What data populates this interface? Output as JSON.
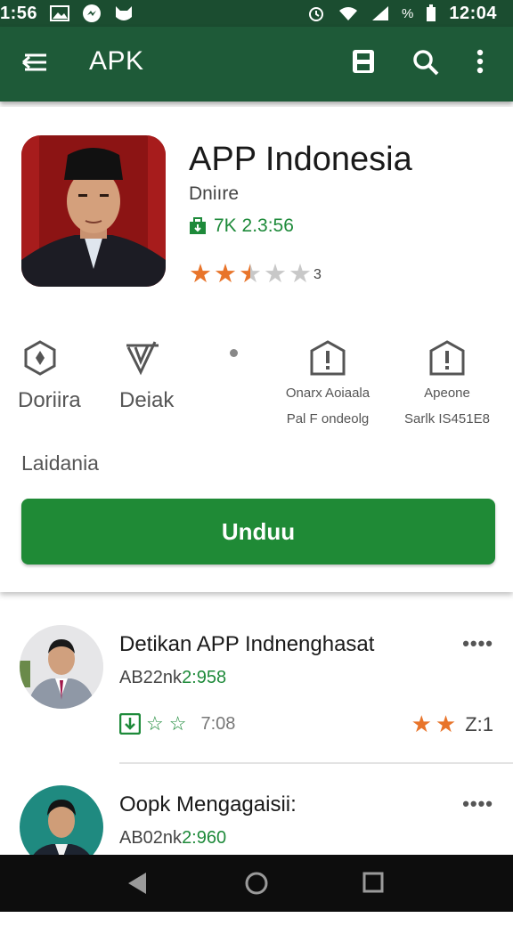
{
  "status": {
    "time_left": "1:56",
    "battery_pct": "%",
    "time_right": "12:04"
  },
  "appbar": {
    "title": "APK",
    "icons": [
      "menu-icon",
      "save-icon",
      "search-icon",
      "more-vert-icon"
    ]
  },
  "app": {
    "title": "APP Indonesia",
    "developer": "Dniıre",
    "meta": "7K 2.3:56",
    "rating_tail": "3",
    "rating": 2.5
  },
  "stats": [
    {
      "label": "Doriira",
      "icon": "hexagon-icon"
    },
    {
      "label": "Deiak",
      "icon": "download-arrow-icon"
    },
    {
      "label_line1": "Onarx Aoiaala",
      "label_line2": "Pal F ondeolg",
      "icon": "info-shield-icon"
    },
    {
      "label_line1": "Apeone",
      "label_line2": "Sarlk IS451E8",
      "icon": "info-shield-icon"
    }
  ],
  "section_label": "Laidania",
  "install_label": "Unduu",
  "list": [
    {
      "title": "Detikan APP Indnenghasat",
      "sub_prefix": "AB22nk",
      "sub_value": "2:958",
      "badge_text": "7:08",
      "right_text": "Z:1",
      "more": "••••"
    },
    {
      "title": "Oopk Mengagaisii:",
      "sub_prefix": "AB02nk",
      "sub_value": "2:960",
      "more": "••••"
    }
  ],
  "colors": {
    "statusbar": "#1b4d30",
    "appbar": "#1e5a38",
    "accent_green": "#1f8a36",
    "star_orange": "#e8742a",
    "star_gray": "#c8c8c8"
  }
}
